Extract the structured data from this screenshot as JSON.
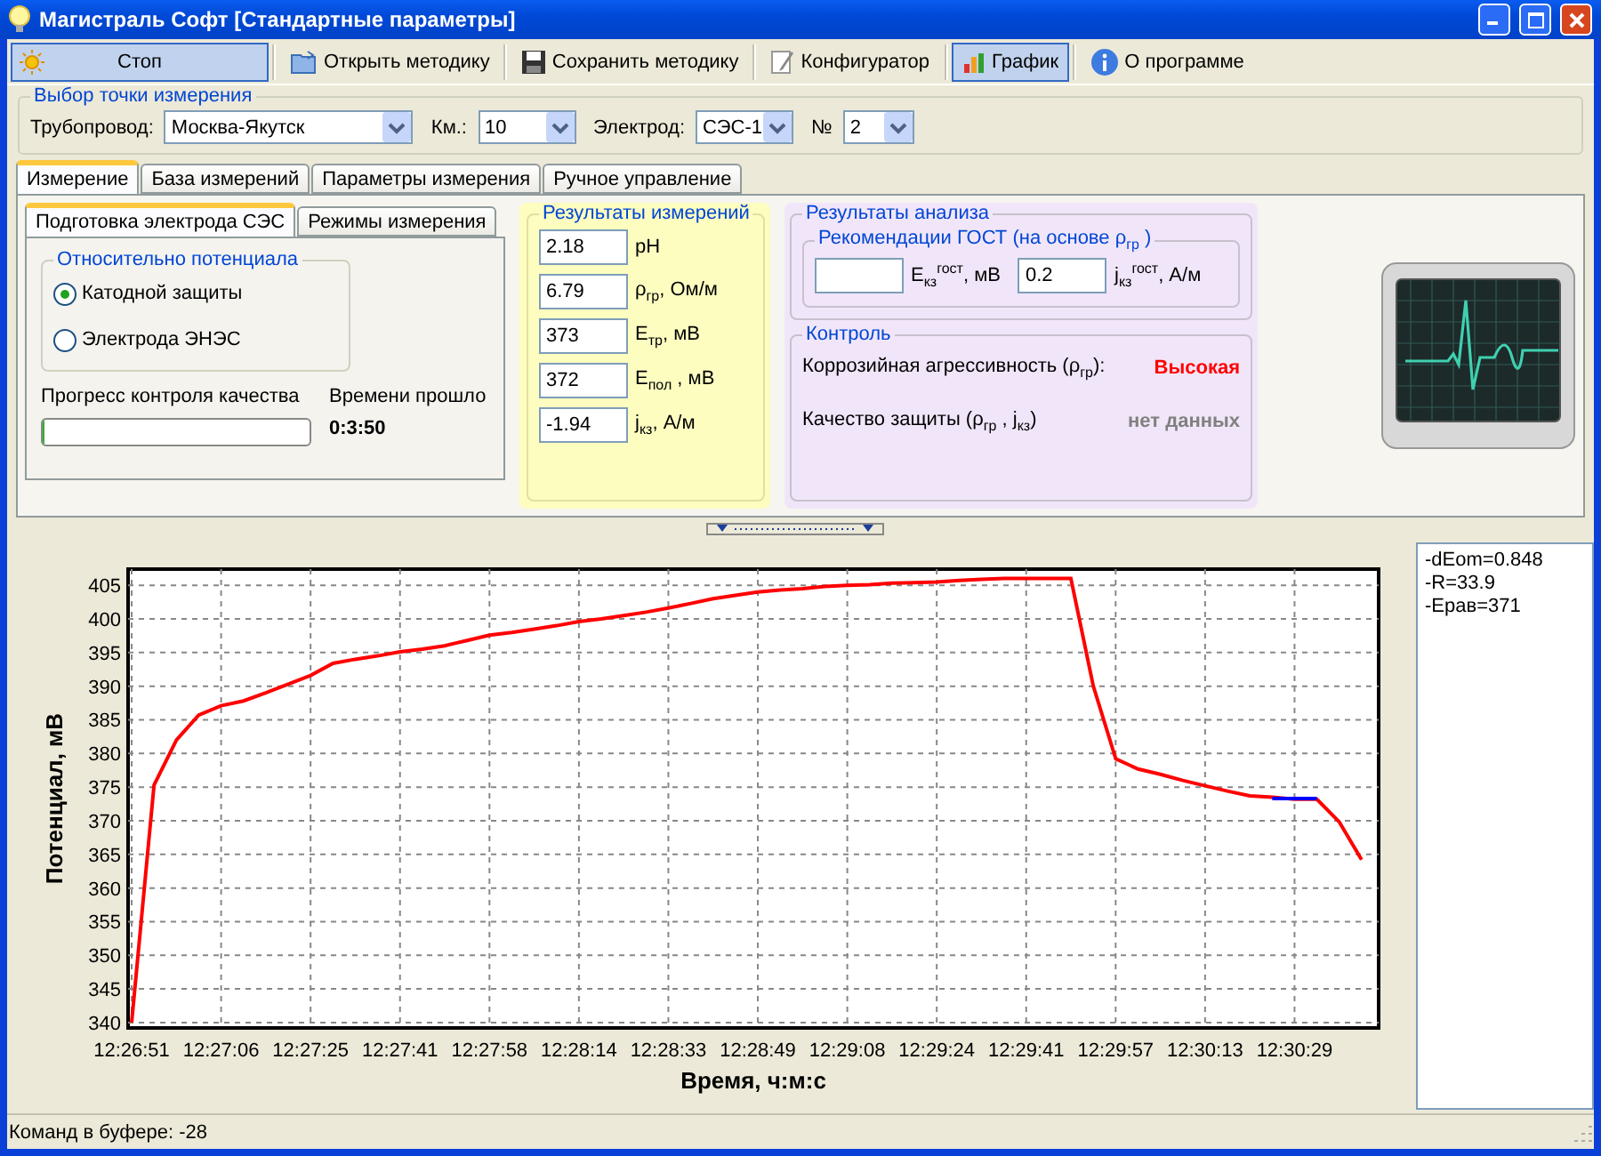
{
  "window": {
    "title": "Магистраль Софт [Стандартные параметры]"
  },
  "toolbar": [
    {
      "label": "Стоп",
      "kind": "stop",
      "selected": true
    },
    {
      "label": "Открыть методику",
      "kind": "open",
      "selected": false
    },
    {
      "label": "Сохранить методику",
      "kind": "save",
      "selected": false
    },
    {
      "label": "Конфигуратор",
      "kind": "config",
      "selected": false
    },
    {
      "label": "График",
      "kind": "chart",
      "selected": true
    },
    {
      "label": "О программе",
      "kind": "about",
      "selected": false
    }
  ],
  "measurement_point": {
    "title": "Выбор точки измерения",
    "fields": [
      {
        "label": "Трубопровод:",
        "value": "Москва-Якутск",
        "kind": "wide"
      },
      {
        "label": "Км.:",
        "value": "10",
        "kind": "short"
      },
      {
        "label": "Электрод:",
        "value": "СЭС-1",
        "kind": "short"
      },
      {
        "label": "№",
        "value": "2",
        "kind": "tiny"
      }
    ]
  },
  "tabs": [
    {
      "label": "Измерение",
      "selected": true
    },
    {
      "label": "База измерений",
      "selected": false
    },
    {
      "label": "Параметры измерения",
      "selected": false
    },
    {
      "label": "Ручное управление",
      "selected": false
    }
  ],
  "subtabs": [
    {
      "label": "Подготовка электрода СЭС",
      "selected": true
    },
    {
      "label": "Режимы измерения",
      "selected": false
    }
  ],
  "potential_group": {
    "title": "Относительно потенциала",
    "options": [
      {
        "label": "Катодной защиты",
        "selected": true
      },
      {
        "label": "Электрода ЭНЭС",
        "selected": false
      }
    ]
  },
  "quality": {
    "label": "Прогресс контроля качества",
    "level": 0,
    "elapsed_label": "Времени прошло",
    "elapsed": "0:3:50"
  },
  "measurements": {
    "title": "Результаты измерений",
    "rows": [
      {
        "value": "2.18",
        "unit": "pH"
      },
      {
        "value": "6.79",
        "unit": "ρ$_{гр}$, Ом/м"
      },
      {
        "value": "373",
        "unit": "E$_{тр}$, мВ"
      },
      {
        "value": "372",
        "unit": "E$_{пол}$ , мВ"
      },
      {
        "value": "-1.94",
        "unit": "j$_{кз}$, А/м"
      }
    ]
  },
  "analysis": {
    "title": "Результаты анализа",
    "gost": {
      "title": "Рекомендации ГОСТ (на основе ρ$_{гр}$ )",
      "fields": [
        {
          "unit": "E$_{кз}$$^{гост}$, мВ"
        },
        {
          "value": "0.2",
          "unit": "j$_{кз}$$^{гост}$, А/м"
        }
      ]
    },
    "control": {
      "title": "Контроль",
      "rows": [
        {
          "label": "Коррозийная агрессивность (ρ$_{гр}$):",
          "value": "Высокая",
          "color": "#ff0000"
        },
        {
          "label": "Качество защиты (ρ$_{гр}$ , j$_{кз}$)",
          "value": "нет данных",
          "color": "#808080"
        }
      ]
    }
  },
  "chart": {
    "chart_data": {
      "type": "line",
      "xlabel": "Время, ч:м:с",
      "ylabel": "Потенциал, мВ",
      "categories": [
        "12:26:51",
        null,
        null,
        null,
        "12:27:06",
        null,
        null,
        null,
        "12:27:25",
        null,
        null,
        null,
        "12:27:41",
        null,
        null,
        null,
        "12:27:58",
        null,
        null,
        null,
        "12:28:14",
        null,
        null,
        null,
        "12:28:33",
        null,
        null,
        null,
        "12:28:49",
        null,
        null,
        null,
        "12:29:08",
        null,
        null,
        null,
        "12:29:24",
        null,
        null,
        null,
        "12:29:41",
        null,
        null,
        null,
        "12:29:57",
        null,
        null,
        null,
        "12:30:13",
        null,
        null,
        null,
        "12:30:29",
        null,
        null,
        null
      ],
      "series": [
        {
          "color": "#ff0000",
          "values": [
            340,
            375.3,
            382,
            385.7,
            387.1,
            387.8,
            389,
            390.3,
            391.6,
            393.4,
            394,
            394.5,
            395.1,
            395.5,
            396,
            396.8,
            397.6,
            398,
            398.5,
            399,
            399.6,
            400,
            400.5,
            401,
            401.6,
            402.3,
            403,
            403.5,
            404,
            404.3,
            404.5,
            404.8,
            405,
            405.1,
            405.3,
            405.4,
            405.5,
            405.7,
            405.9,
            406,
            406,
            406,
            406,
            390,
            379.2,
            377.7,
            376.9,
            376,
            375.2,
            374.4,
            373.7,
            373.5,
            373.2,
            373.2,
            369.8,
            364.2
          ]
        },
        {
          "color": "#0000ff",
          "values": [
            null,
            null,
            null,
            null,
            null,
            null,
            null,
            null,
            null,
            null,
            null,
            null,
            null,
            null,
            null,
            null,
            null,
            null,
            null,
            null,
            null,
            null,
            null,
            null,
            null,
            null,
            null,
            null,
            null,
            null,
            null,
            null,
            null,
            null,
            null,
            null,
            null,
            null,
            null,
            null,
            null,
            null,
            null,
            null,
            null,
            null,
            null,
            null,
            null,
            null,
            null,
            373.3,
            373.3,
            373.3,
            null,
            null
          ]
        }
      ],
      "grid": true,
      "ylim": [
        339.2,
        407.4
      ],
      "yticks": [
        340,
        345,
        350,
        355,
        360,
        365,
        370,
        375,
        380,
        385,
        390,
        395,
        400,
        405
      ]
    }
  },
  "legend": [
    "-dEom=0.848",
    "-R=33.9",
    "-Eрав=371"
  ],
  "status_bar": "Команд в буфере: -28"
}
